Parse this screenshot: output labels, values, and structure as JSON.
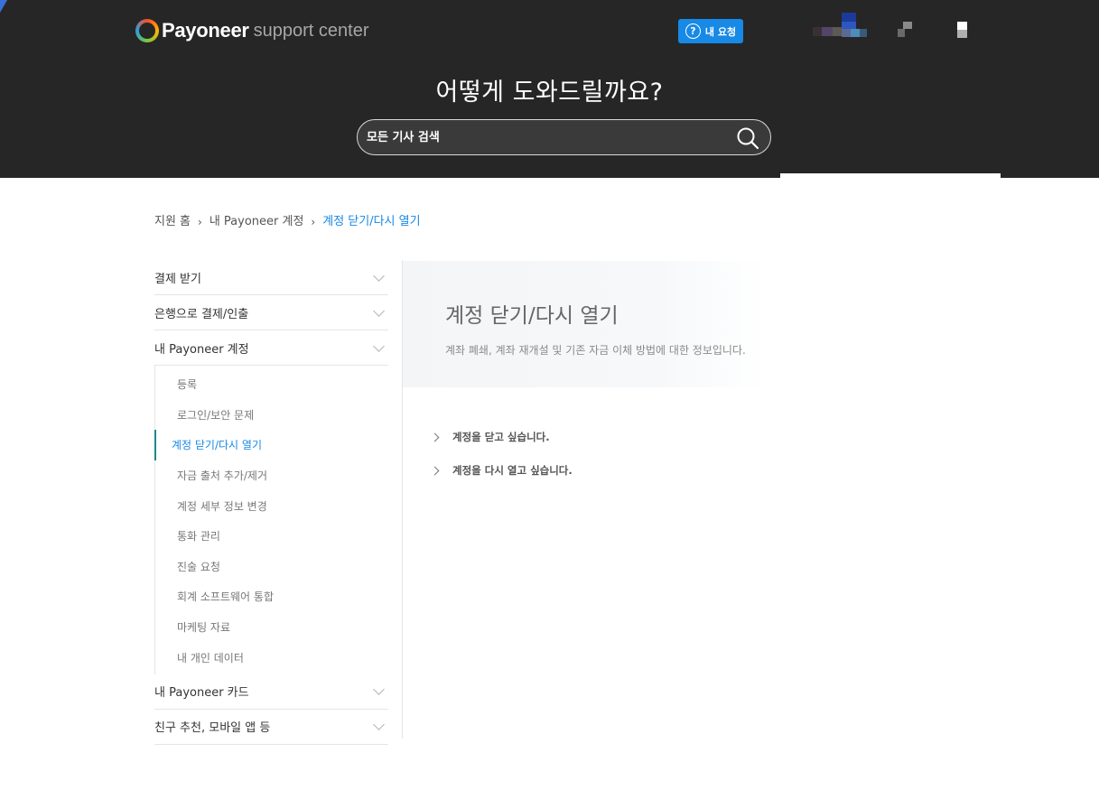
{
  "header": {
    "brand": "Payoneer",
    "brand_sub": "support center",
    "request_button": "내 요청",
    "hero_title": "어떻게 도와드릴까요?",
    "search_placeholder": "모든 기사 검색",
    "accent_color": "#1789e6",
    "background_color": "#262626"
  },
  "breadcrumb": {
    "items": [
      "지원 홈",
      "내 Payoneer 계정",
      "계정 닫기/다시 열기"
    ]
  },
  "sidebar": {
    "categories": [
      {
        "label": "결제 받기"
      },
      {
        "label": "은행으로 결제/인출"
      },
      {
        "label": "내 Payoneer 계정"
      },
      {
        "label": "내 Payoneer 카드"
      },
      {
        "label": "친구 추천, 모바일 앱 등"
      }
    ],
    "subitems": [
      {
        "label": "등록"
      },
      {
        "label": "로그인/보안 문제"
      },
      {
        "label": "계정 닫기/다시 열기",
        "active": true
      },
      {
        "label": "자금 출처 추가/제거"
      },
      {
        "label": "계정 세부 정보 변경"
      },
      {
        "label": "통화 관리"
      },
      {
        "label": "진술 요청"
      },
      {
        "label": "회계 소프트웨어 통합"
      },
      {
        "label": "마케팅 자료"
      },
      {
        "label": "내 개인 데이터"
      }
    ]
  },
  "main": {
    "title": "계정 닫기/다시 열기",
    "description": "계좌 폐쇄, 계좌 재개설 및 기존 자금 이체 방법에 대한 정보입니다.",
    "articles": [
      {
        "label": "계정을 닫고 싶습니다."
      },
      {
        "label": "계정을 다시 열고 싶습니다."
      }
    ]
  }
}
